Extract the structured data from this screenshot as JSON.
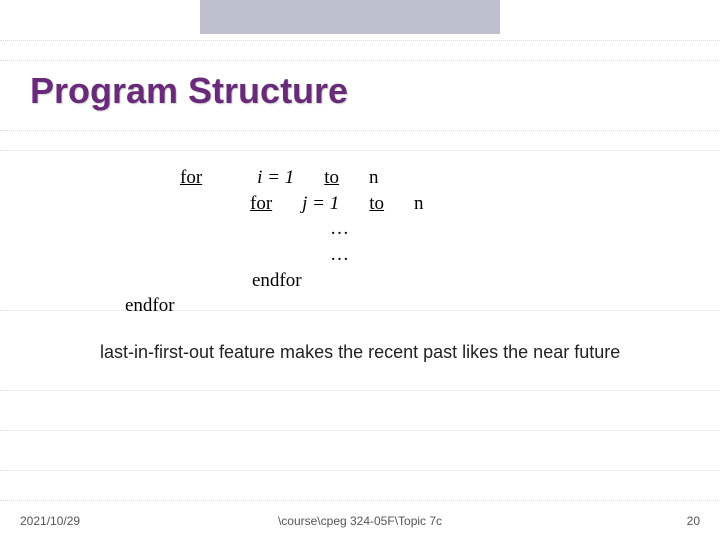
{
  "slide": {
    "title": "Program Structure"
  },
  "code": {
    "for_kw": "for",
    "i_expr": "i = 1",
    "to_kw": "to",
    "n": "n",
    "j_expr": "j = 1",
    "dots": "…",
    "endfor": "endfor"
  },
  "body": {
    "text": "last-in-first-out feature makes the recent past likes the near future"
  },
  "footer": {
    "date": "2021/10/29",
    "path": "\\course\\cpeg 324-05F\\Topic 7c",
    "page": "20"
  }
}
